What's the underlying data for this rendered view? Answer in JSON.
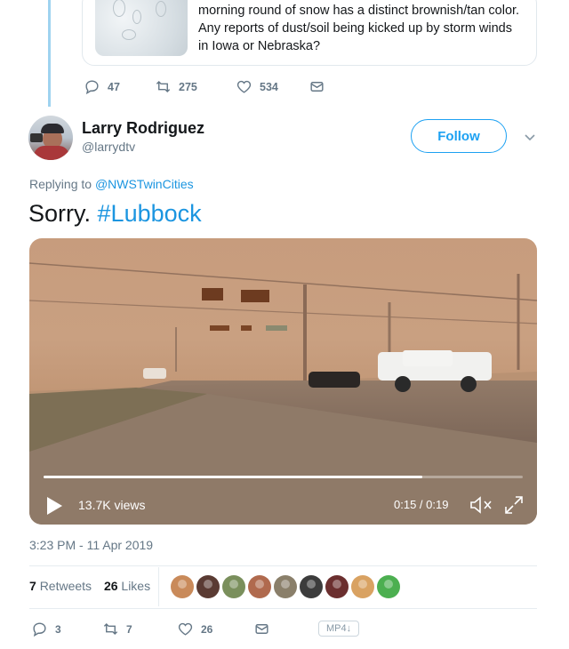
{
  "quoted_tweet": {
    "text_lines": [
      "morning round of snow has a distinct brownish/tan color.",
      "Any reports of dust/soil being kicked up by storm winds",
      "in Iowa or Nebraska?"
    ]
  },
  "parent_actions": {
    "replies": "47",
    "retweets": "275",
    "likes": "534"
  },
  "tweet": {
    "display_name": "Larry Rodriguez",
    "handle": "@larrydtv",
    "follow_label": "Follow",
    "replying_prefix": "Replying to",
    "replying_to": "@NWSTwinCities",
    "text": "Sorry.",
    "hashtag": "#Lubbock",
    "timestamp": "3:23 PM - 11 Apr 2019"
  },
  "video": {
    "views": "13.7K views",
    "time": "0:15 / 0:19",
    "progress": 0.79
  },
  "stats": {
    "retweets_count": "7",
    "retweets_label": "Retweets",
    "likes_count": "26",
    "likes_label": "Likes"
  },
  "likers": [
    {
      "color": "#c98a5a"
    },
    {
      "color": "#5a3b33"
    },
    {
      "color": "#7a8f5c"
    },
    {
      "color": "#b06a4e"
    },
    {
      "color": "#8a7f6a"
    },
    {
      "color": "#3c3c3c"
    },
    {
      "color": "#6b2f2f"
    },
    {
      "color": "#d9a262"
    },
    {
      "color": "#4caf50"
    }
  ],
  "bottom_actions": {
    "replies": "3",
    "retweets": "7",
    "likes": "26",
    "badge": "MP4"
  },
  "icons": [
    "reply-icon",
    "retweet-icon",
    "heart-icon",
    "envelope-icon",
    "play-icon",
    "mute-icon",
    "fullscreen-icon",
    "chevron-down-icon"
  ]
}
